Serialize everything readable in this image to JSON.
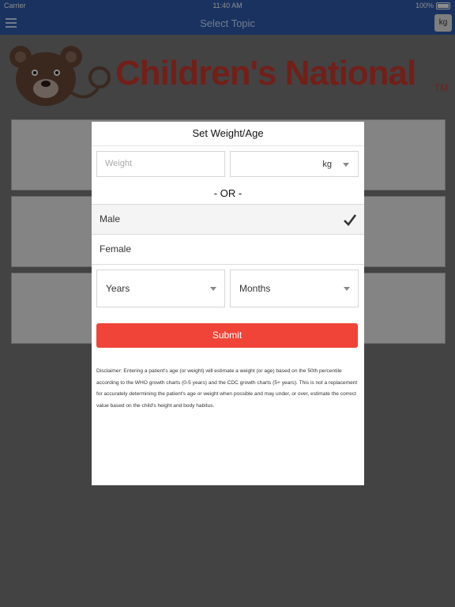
{
  "status_bar": {
    "carrier": "Carrier",
    "time": "11:40 AM",
    "battery": "100%"
  },
  "nav": {
    "title": "Select Topic",
    "unit_button": "kg"
  },
  "logo": {
    "text": "Children's National",
    "tm": "TM"
  },
  "modal": {
    "title": "Set Weight/Age",
    "weight_placeholder": "Weight",
    "unit_value": "kg",
    "or_label": "- OR -",
    "genders": [
      {
        "label": "Male",
        "selected": true
      },
      {
        "label": "Female",
        "selected": false
      }
    ],
    "years_label": "Years",
    "months_label": "Months",
    "submit_label": "Submit",
    "disclaimer": "Disclaimer: Entering a patient's age (or weight) will estimate a weight (or age) based on the 50th percentile according to the WHO growth charts (0-5 years) and the CDC growth charts (5+ years). This is not a replacement for accurately determining the patient's age or weight when possible and may under, or over, estimate the correct value based on the child's height and body habitus."
  },
  "colors": {
    "nav_bg": "#2f5bb0",
    "brand_red": "#d13a2e",
    "submit_bg": "#ef4437"
  }
}
